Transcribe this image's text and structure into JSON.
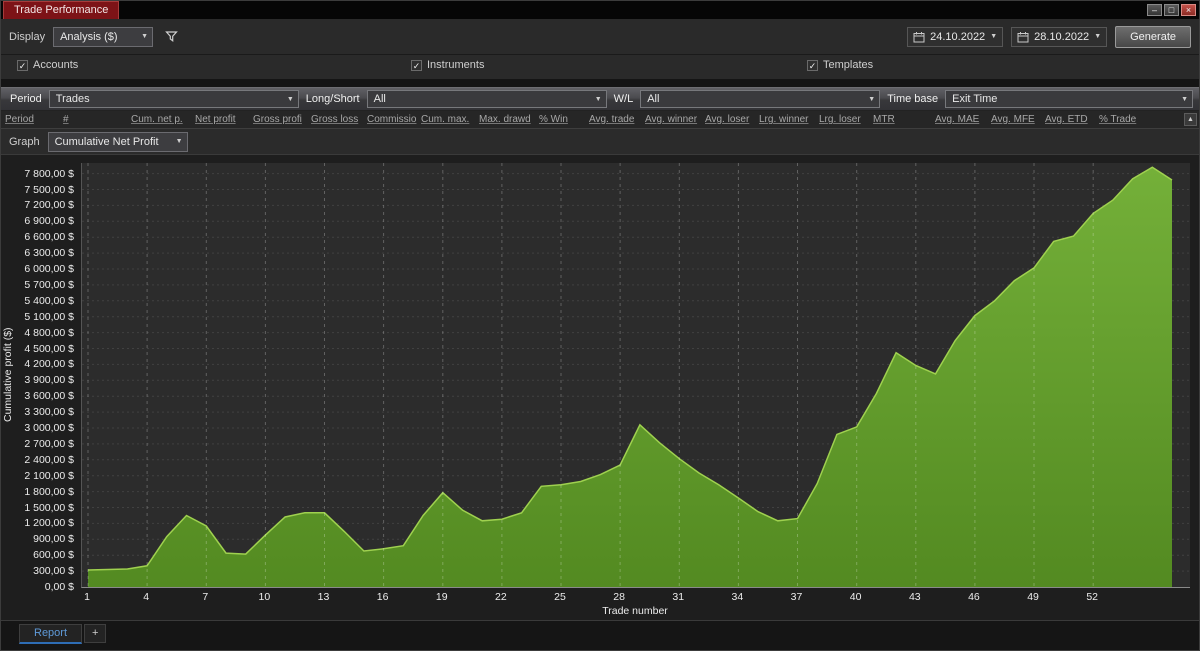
{
  "window": {
    "title": "Trade Performance",
    "minimize_icon": "–",
    "maximize_icon": "□",
    "close_icon": "×"
  },
  "icons": {
    "chevron_down": "▼",
    "scroll_up": "▲",
    "check": "✓"
  },
  "toolbar": {
    "display_label": "Display",
    "display_value": "Analysis ($)",
    "date_from": "24.10.2022",
    "date_to": "28.10.2022",
    "generate": "Generate"
  },
  "checkboxes": {
    "accounts": "Accounts",
    "instruments": "Instruments",
    "templates": "Templates"
  },
  "filter_bar": {
    "period_label": "Period",
    "period_value": "Trades",
    "longshort_label": "Long/Short",
    "longshort_value": "All",
    "wl_label": "W/L",
    "wl_value": "All",
    "timebase_label": "Time base",
    "timebase_value": "Exit Time"
  },
  "table": {
    "columns": [
      "Period",
      "#",
      "Cum. net p.",
      "Net profit",
      "Gross profi",
      "Gross loss",
      "Commissio",
      "Cum. max.",
      "Max. drawd",
      "% Win",
      "Avg. trade",
      "Avg. winner",
      "Avg. loser",
      "Lrg. winner",
      "Lrg. loser",
      "MTR",
      "Avg. MAE",
      "Avg. MFE",
      "Avg. ETD",
      "% Trade"
    ]
  },
  "graph_bar": {
    "label": "Graph",
    "value": "Cumulative Net Profit"
  },
  "tabs": {
    "report": "Report",
    "add": "+"
  },
  "chart_data": {
    "type": "area",
    "title": "Cumulative Net Profit",
    "xlabel": "Trade number",
    "ylabel": "Cumulative profit ($)",
    "x_ticks": [
      1,
      4,
      7,
      10,
      13,
      16,
      19,
      22,
      25,
      28,
      31,
      34,
      37,
      40,
      43,
      46,
      49,
      52
    ],
    "y_ticks": [
      0,
      300,
      600,
      900,
      1200,
      1500,
      1800,
      2100,
      2400,
      2700,
      3000,
      3300,
      3600,
      3900,
      4200,
      4500,
      4800,
      5100,
      5400,
      5700,
      6000,
      6300,
      6600,
      6900,
      7200,
      7500,
      7800
    ],
    "y_tick_labels": [
      "0,00 $",
      "300,00 $",
      "600,00 $",
      "900,00 $",
      "1 200,00 $",
      "1 500,00 $",
      "1 800,00 $",
      "2 100,00 $",
      "2 400,00 $",
      "2 700,00 $",
      "3 000,00 $",
      "3 300,00 $",
      "3 600,00 $",
      "3 900,00 $",
      "4 200,00 $",
      "4 500,00 $",
      "4 800,00 $",
      "5 100,00 $",
      "5 400,00 $",
      "5 700,00 $",
      "6 000,00 $",
      "6 300,00 $",
      "6 600,00 $",
      "6 900,00 $",
      "7 200,00 $",
      "7 500,00 $",
      "7 800,00 $"
    ],
    "x": [
      1,
      2,
      3,
      4,
      5,
      6,
      7,
      8,
      9,
      10,
      11,
      12,
      13,
      14,
      15,
      16,
      17,
      18,
      19,
      20,
      21,
      22,
      23,
      24,
      25,
      26,
      27,
      28,
      29,
      30,
      31,
      32,
      33,
      34,
      35,
      36,
      37,
      38,
      39,
      40,
      41,
      42,
      43,
      44,
      45,
      46,
      47,
      48,
      49,
      50,
      51,
      52,
      53,
      54,
      55,
      56
    ],
    "values": [
      320,
      330,
      340,
      400,
      950,
      1350,
      1150,
      640,
      620,
      980,
      1320,
      1400,
      1400,
      1050,
      680,
      720,
      780,
      1350,
      1780,
      1450,
      1250,
      1280,
      1400,
      1900,
      1930,
      1990,
      2120,
      2300,
      3060,
      2720,
      2420,
      2150,
      1930,
      1680,
      1420,
      1250,
      1290,
      1950,
      2880,
      3020,
      3650,
      4420,
      4180,
      4020,
      4650,
      5120,
      5400,
      5780,
      6020,
      6520,
      6620,
      7050,
      7300,
      7700,
      7920,
      7680
    ],
    "ylim": [
      0,
      8000
    ],
    "grid": true,
    "legend": false,
    "line_color": "#9fd14f",
    "fill_top": "#74b039",
    "fill_bottom": "#538a21"
  }
}
